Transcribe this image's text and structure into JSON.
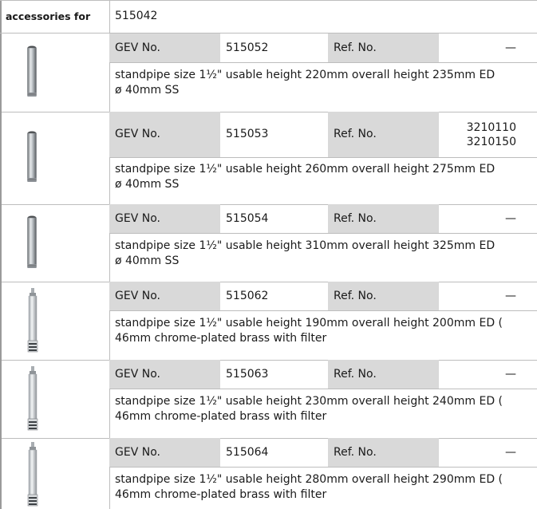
{
  "header": {
    "label": "accessories for",
    "value": "515042"
  },
  "labels": {
    "gev": "GEV No.",
    "ref": "Ref. No."
  },
  "items": [
    {
      "gev_no": "515052",
      "ref_no": "—",
      "desc_line1": "standpipe  size 1½\" usable height 220mm overall height 235mm ED",
      "desc_line2": "ø 40mm SS",
      "thumb_icon": "plain-pipe-icon"
    },
    {
      "gev_no": "515053",
      "ref_no": "3210110\n3210150",
      "desc_line1": "standpipe  size 1½\" usable height 260mm overall height 275mm ED",
      "desc_line2": "ø 40mm SS",
      "thumb_icon": "plain-pipe-icon"
    },
    {
      "gev_no": "515054",
      "ref_no": "—",
      "desc_line1": "standpipe  size 1½\" usable height 310mm overall height 325mm ED",
      "desc_line2": "ø 40mm SS",
      "thumb_icon": "plain-pipe-icon"
    },
    {
      "gev_no": "515062",
      "ref_no": "—",
      "desc_line1": "standpipe  size 1½\" usable height 190mm overall height 200mm ED (",
      "desc_line2": "46mm chrome-plated brass with filter",
      "thumb_icon": "filter-pipe-icon"
    },
    {
      "gev_no": "515063",
      "ref_no": "—",
      "desc_line1": "standpipe  size 1½\" usable height 230mm overall height 240mm ED (",
      "desc_line2": "46mm chrome-plated brass with filter",
      "thumb_icon": "filter-pipe-icon"
    },
    {
      "gev_no": "515064",
      "ref_no": "—",
      "desc_line1": "standpipe  size 1½\" usable height 280mm overall height 290mm ED (",
      "desc_line2": "46mm chrome-plated brass with filter",
      "thumb_icon": "filter-pipe-icon"
    }
  ]
}
